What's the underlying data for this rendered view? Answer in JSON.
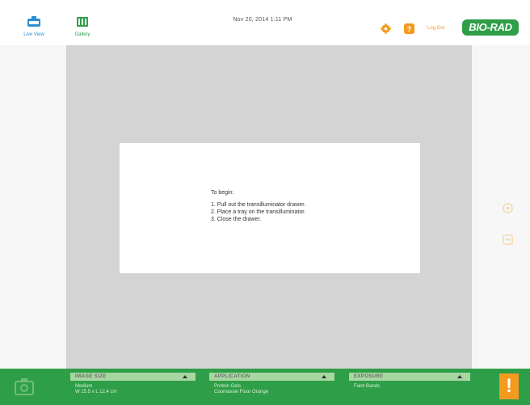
{
  "header": {
    "live_view_label": "Live View",
    "gallery_label": "Gallery",
    "datetime": "Nov 20, 2014   1:11 PM",
    "logout_label": "Log Out",
    "logo_text": "BIO-RAD",
    "accent_color": "#f39a1f",
    "brand_color": "#2f9e48"
  },
  "dialog": {
    "intro": "To begin:",
    "steps": [
      "1. Pull out the transilluminator drawer.",
      "2. Place a tray on the transilluminator.",
      "3. Close the drawer."
    ]
  },
  "bottom_bar": {
    "image_size": {
      "title": "IMAGE SIZE",
      "line1": "Medium",
      "line2": "W 15.5 x L 12.4 cm"
    },
    "application": {
      "title": "APPLICATION",
      "line1": "Protein Gels",
      "line2": "Coomassie Fluor Orange"
    },
    "exposure": {
      "title": "EXPOSURE",
      "line1": "Faint Bands"
    },
    "alert_symbol": "!"
  }
}
